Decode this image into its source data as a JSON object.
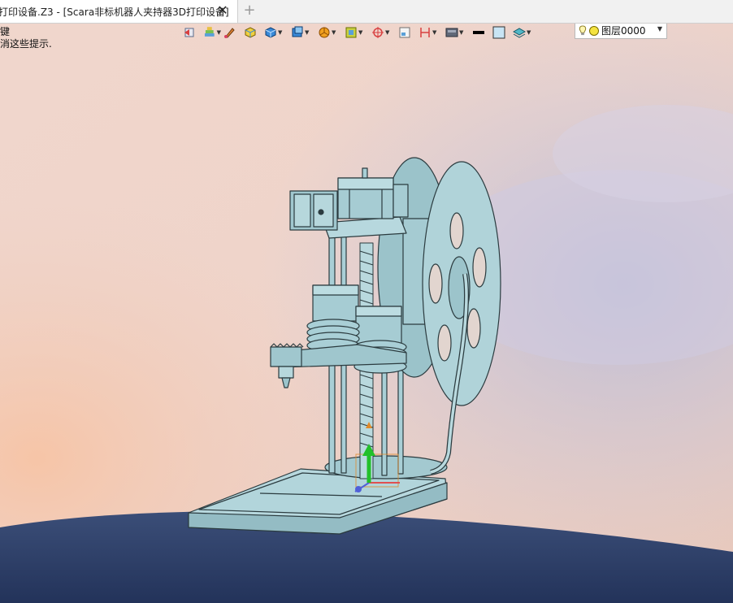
{
  "tab": {
    "title": "打印设备.Z3 - [Scara非标机器人夹持器3D打印设备]",
    "close_icon": "close-icon",
    "new_tab_icon": "plus-icon"
  },
  "hint": {
    "line1": "键",
    "line2": "消这些提示."
  },
  "toolbar": {
    "buttons": [
      {
        "name": "back-view-icon"
      },
      {
        "name": "layers-display-icon"
      },
      {
        "name": "brush-icon"
      },
      {
        "name": "shaded-cube-icon"
      },
      {
        "name": "cube-render-icon"
      },
      {
        "name": "view-orientation-icon"
      },
      {
        "name": "pie-filter-icon"
      },
      {
        "name": "frame-select-icon"
      },
      {
        "name": "pick-point-icon"
      },
      {
        "name": "sheet-icon"
      },
      {
        "name": "dimension-icon"
      },
      {
        "name": "display-mode-icon"
      },
      {
        "name": "line-color-icon"
      },
      {
        "name": "fill-color-icon"
      },
      {
        "name": "layer-stack-icon"
      }
    ],
    "layer_label": "图层0000"
  },
  "colors": {
    "model": "#a9cfd6",
    "model_edge": "#2b3b3f",
    "floor": "#2c3d66",
    "sky_warm": "#f0cdbf",
    "sky_cool": "#c9c8de"
  }
}
